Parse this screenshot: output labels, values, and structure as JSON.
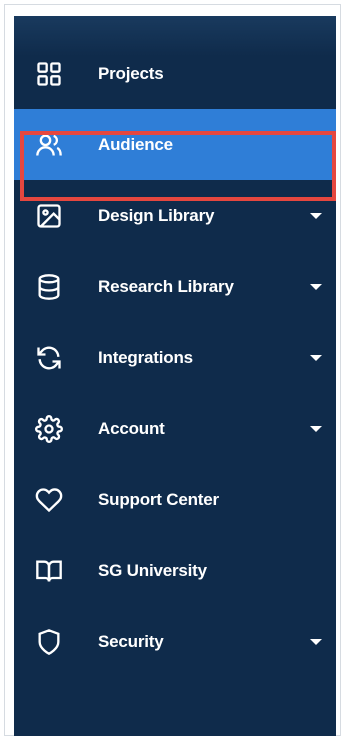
{
  "sidebar": {
    "items": [
      {
        "label": "Projects",
        "icon": "grid-icon",
        "has_caret": false
      },
      {
        "label": "Audience",
        "icon": "users-icon",
        "has_caret": false,
        "active": true
      },
      {
        "label": "Design Library",
        "icon": "image-icon",
        "has_caret": true
      },
      {
        "label": "Research Library",
        "icon": "database-icon",
        "has_caret": true
      },
      {
        "label": "Integrations",
        "icon": "refresh-icon",
        "has_caret": true
      },
      {
        "label": "Account",
        "icon": "gear-icon",
        "has_caret": true
      },
      {
        "label": "Support Center",
        "icon": "heart-icon",
        "has_caret": false
      },
      {
        "label": "SG University",
        "icon": "book-icon",
        "has_caret": false
      },
      {
        "label": "Security",
        "icon": "shield-icon",
        "has_caret": true
      }
    ]
  },
  "colors": {
    "sidebar_bg": "#0f2b4b",
    "active_bg": "#2f7ed7",
    "highlight_border": "#e5473f",
    "text": "#ffffff"
  }
}
